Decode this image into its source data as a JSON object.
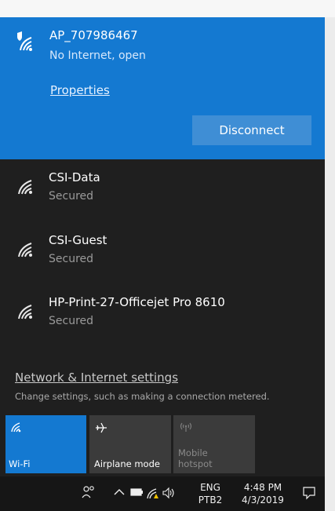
{
  "connected_network": {
    "name": "AP_707986467",
    "status": "No Internet, open",
    "properties_label": "Properties",
    "disconnect_label": "Disconnect"
  },
  "networks": [
    {
      "name": "CSI-Data",
      "status": "Secured"
    },
    {
      "name": "CSI-Guest",
      "status": "Secured"
    },
    {
      "name": "HP-Print-27-Officejet Pro 8610",
      "status": "Secured"
    }
  ],
  "settings": {
    "link_label": "Network & Internet settings",
    "description": "Change settings, such as making a connection metered."
  },
  "quick_actions": [
    {
      "label": "Wi-Fi",
      "icon": "wifi-icon",
      "state": "on"
    },
    {
      "label": "Airplane mode",
      "icon": "airplane-icon",
      "state": "off"
    },
    {
      "label_line1": "Mobile",
      "label_line2": "hotspot",
      "icon": "hotspot-icon",
      "state": "disabled"
    }
  ],
  "taskbar": {
    "language": "ENG",
    "keyboard": "PTB2",
    "time": "4:48 PM",
    "date": "4/3/2019"
  },
  "colors": {
    "accent": "#1479d1",
    "panel_bg": "#1f1f1f",
    "tile_inactive": "#3b3b3b",
    "taskbar_bg": "#161616"
  }
}
